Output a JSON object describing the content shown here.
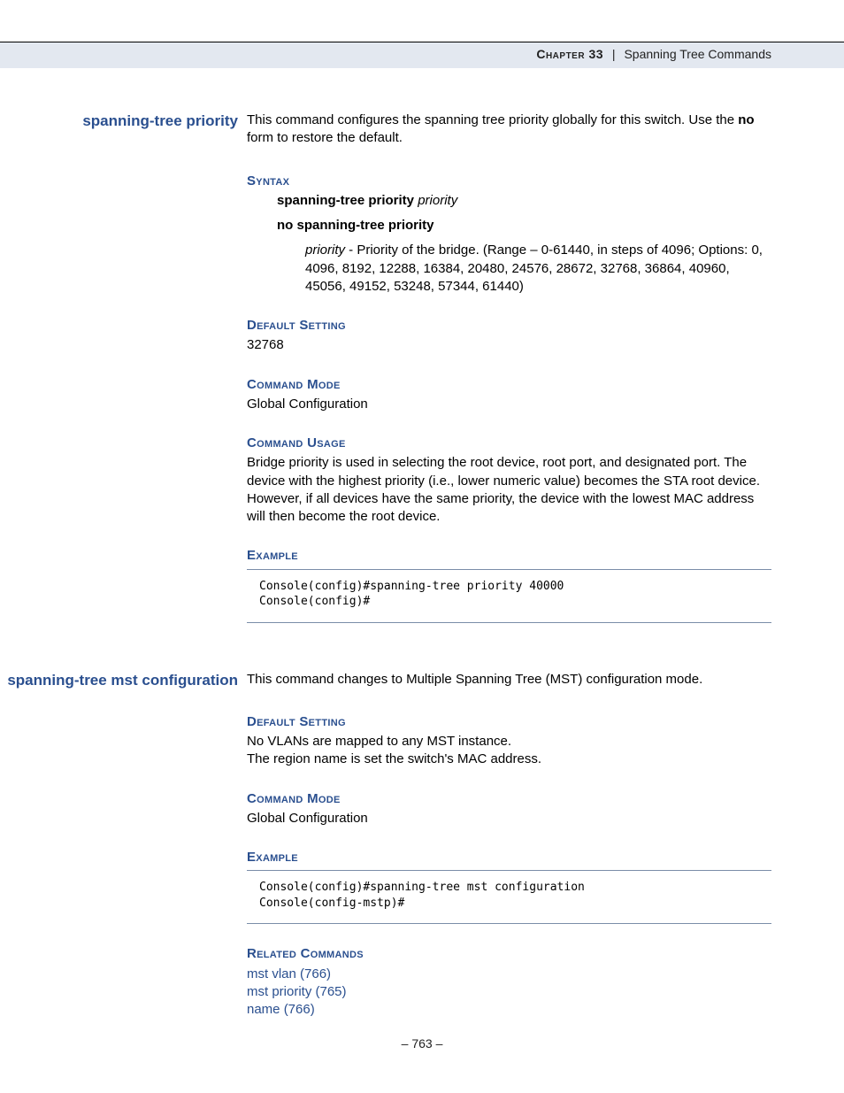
{
  "header": {
    "chapter": "Chapter 33",
    "separator": "|",
    "title": "Spanning Tree Commands"
  },
  "page_number": "– 763 –",
  "section1": {
    "title": "spanning-tree priority",
    "intro_a": "This command configures the spanning tree priority globally for this switch. Use the ",
    "intro_no": "no",
    "intro_b": " form to restore the default.",
    "syntax_head": "Syntax",
    "syntax_line1_bold": "spanning-tree priority ",
    "syntax_line1_italic": "priority",
    "syntax_line2_bold": "no spanning-tree priority",
    "syntax_param_italic": "priority",
    "syntax_param_rest": " - Priority of the bridge. (Range – 0-61440, in steps of 4096; Options: 0, 4096, 8192, 12288, 16384, 20480, 24576, 28672, 32768, 36864, 40960, 45056, 49152, 53248, 57344, 61440)",
    "default_head": "Default Setting",
    "default_value": "32768",
    "mode_head": "Command Mode",
    "mode_value": "Global Configuration",
    "usage_head": "Command Usage",
    "usage_text": "Bridge priority is used in selecting the root device, root port, and designated port. The device with the highest priority (i.e., lower numeric value) becomes the STA root device. However, if all devices have the same priority, the device with the lowest MAC address will then become the root device.",
    "example_head": "Example",
    "example_code": "Console(config)#spanning-tree priority 40000\nConsole(config)#"
  },
  "section2": {
    "title": "spanning-tree mst configuration",
    "intro": "This command changes to Multiple Spanning Tree (MST) configuration mode.",
    "default_head": "Default Setting",
    "default_line1": "No VLANs are mapped to any MST instance.",
    "default_line2": "The region name is set the switch's MAC address.",
    "mode_head": "Command Mode",
    "mode_value": "Global Configuration",
    "example_head": "Example",
    "example_code": "Console(config)#spanning-tree mst configuration\nConsole(config-mstp)#",
    "related_head": "Related Commands",
    "rel1": "mst vlan (766)",
    "rel2": "mst priority (765)",
    "rel3": "name (766)"
  }
}
